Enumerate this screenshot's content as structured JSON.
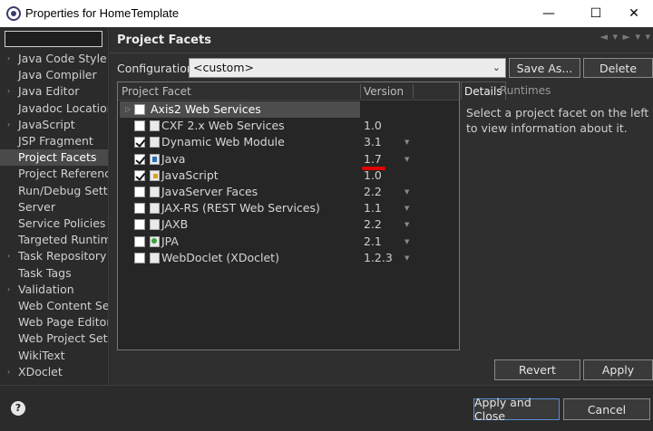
{
  "window": {
    "title": "Properties for HomeTemplate",
    "minimize": "—",
    "maximize": "☐",
    "close": "✕"
  },
  "sidebar": {
    "filter_value": "",
    "items": [
      {
        "label": "Java Code Style",
        "expandable": true
      },
      {
        "label": "Java Compiler",
        "expandable": false
      },
      {
        "label": "Java Editor",
        "expandable": true
      },
      {
        "label": "Javadoc Location",
        "expandable": false
      },
      {
        "label": "JavaScript",
        "expandable": true
      },
      {
        "label": "JSP Fragment",
        "expandable": false
      },
      {
        "label": "Project Facets",
        "expandable": false,
        "selected": true
      },
      {
        "label": "Project Reference",
        "expandable": false
      },
      {
        "label": "Run/Debug Setti",
        "expandable": false
      },
      {
        "label": "Server",
        "expandable": false
      },
      {
        "label": "Service Policies",
        "expandable": false
      },
      {
        "label": "Targeted Runtim",
        "expandable": false
      },
      {
        "label": "Task Repository",
        "expandable": true
      },
      {
        "label": "Task Tags",
        "expandable": false
      },
      {
        "label": "Validation",
        "expandable": true
      },
      {
        "label": "Web Content Se",
        "expandable": false
      },
      {
        "label": "Web Page Editor",
        "expandable": false
      },
      {
        "label": "Web Project Setti",
        "expandable": false
      },
      {
        "label": "WikiText",
        "expandable": false
      },
      {
        "label": "XDoclet",
        "expandable": true
      }
    ]
  },
  "page": {
    "title": "Project Facets",
    "nav_arrows": "◄ ▾ ► ▾ ▾"
  },
  "configuration": {
    "label": "Configuration:",
    "value": "<custom>",
    "save_as": "Save As...",
    "delete": "Delete"
  },
  "facets": {
    "col_facet": "Project Facet",
    "col_version": "Version",
    "rows": [
      {
        "name": "Axis2 Web Services",
        "version": "",
        "checked": false,
        "expandable": true,
        "selected": true,
        "icon": "none"
      },
      {
        "name": "CXF 2.x Web Services",
        "version": "1.0",
        "checked": false,
        "icon": "file"
      },
      {
        "name": "Dynamic Web Module",
        "version": "3.1",
        "checked": true,
        "icon": "file",
        "dropdown": true
      },
      {
        "name": "Java",
        "version": "1.7",
        "checked": true,
        "icon": "java",
        "dropdown": true
      },
      {
        "name": "JavaScript",
        "version": "1.0",
        "checked": true,
        "icon": "js"
      },
      {
        "name": "JavaServer Faces",
        "version": "2.2",
        "checked": false,
        "icon": "file",
        "dropdown": true
      },
      {
        "name": "JAX-RS (REST Web Services)",
        "version": "1.1",
        "checked": false,
        "icon": "file",
        "dropdown": true
      },
      {
        "name": "JAXB",
        "version": "2.2",
        "checked": false,
        "icon": "file",
        "dropdown": true
      },
      {
        "name": "JPA",
        "version": "2.1",
        "checked": false,
        "icon": "jpa",
        "dropdown": true
      },
      {
        "name": "WebDoclet (XDoclet)",
        "version": "1.2.3",
        "checked": false,
        "icon": "file",
        "dropdown": true
      }
    ],
    "highlight_color": "#e00000"
  },
  "details": {
    "tab_details": "Details",
    "tab_runtimes": "Runtimes",
    "text": "Select a project facet on the left to view information about it."
  },
  "actions": {
    "revert": "Revert",
    "apply": "Apply",
    "apply_close": "Apply and Close",
    "cancel": "Cancel",
    "help": "?"
  }
}
